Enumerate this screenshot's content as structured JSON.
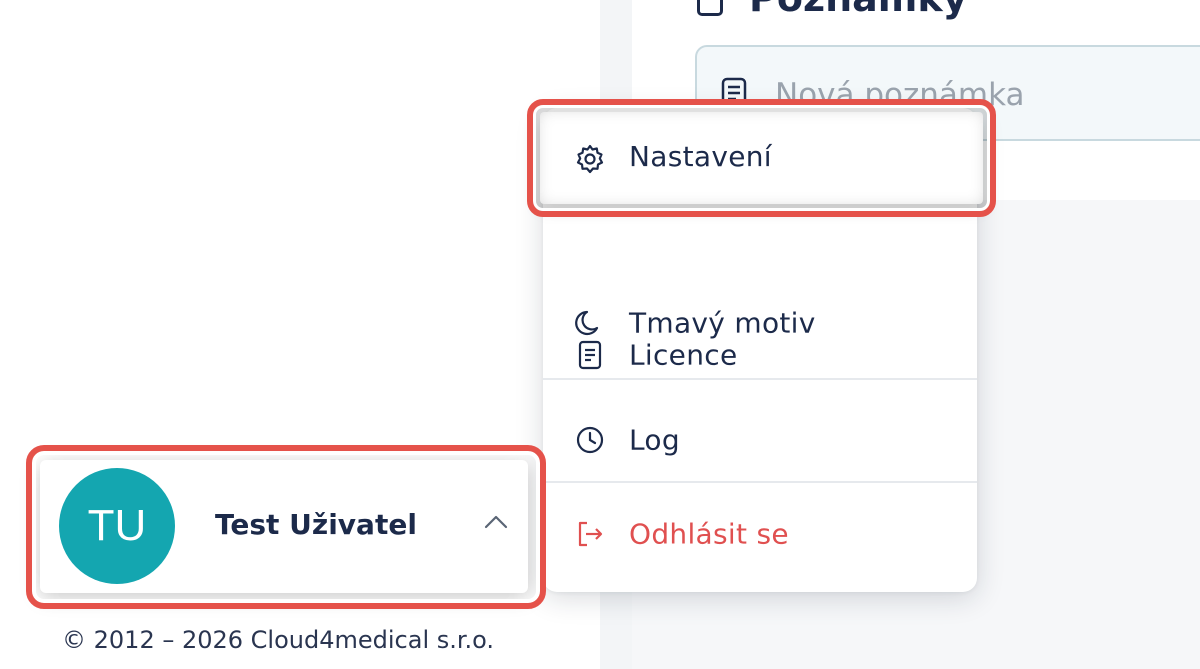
{
  "notes": {
    "title": "Poznámky",
    "input_placeholder": "Nová poznámka"
  },
  "menu": {
    "items": [
      {
        "label": "Nastavení",
        "icon": "gear-icon"
      },
      {
        "label": "Licence",
        "icon": "document-icon"
      },
      {
        "label": "Log",
        "icon": "clock-icon"
      },
      {
        "label": "Tmavý motiv",
        "icon": "moon-icon"
      },
      {
        "label": "Odhlásit se",
        "icon": "logout-icon"
      }
    ]
  },
  "user": {
    "initials": "TU",
    "name": "Test Uživatel",
    "avatar_color": "#14a6b0"
  },
  "footer": {
    "copyright": "© 2012 – 2026 Cloud4medical s.r.o."
  },
  "colors": {
    "accent": "#14a6b0",
    "danger": "#e05050",
    "highlight": "#e5524a",
    "text": "#1c2a4a"
  }
}
